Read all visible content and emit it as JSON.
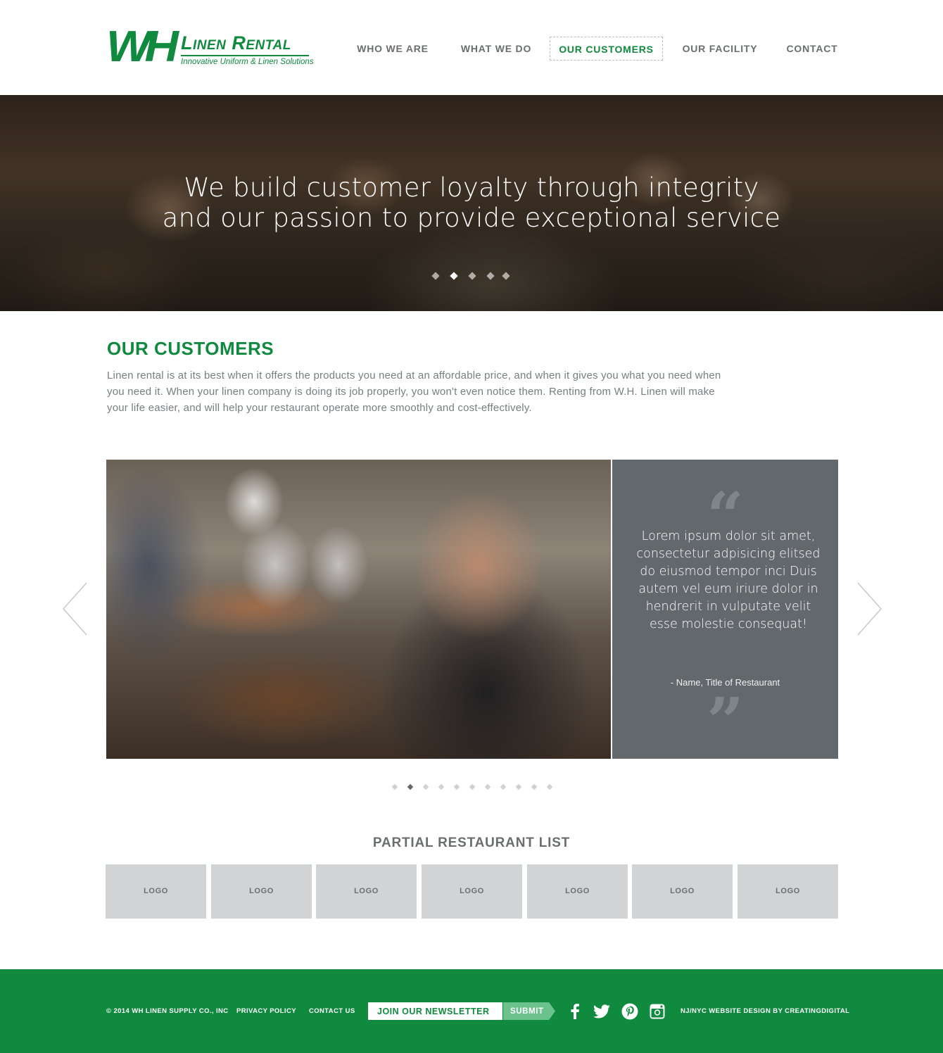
{
  "brand": {
    "logo_mark": "WH",
    "name": "Linen Rental",
    "tagline": "Innovative Uniform & Linen Solutions",
    "color": "#0f8a3e"
  },
  "nav": {
    "items": [
      {
        "label": "WHO WE ARE",
        "active": false
      },
      {
        "label": "WHAT WE DO",
        "active": false
      },
      {
        "label": "OUR CUSTOMERS",
        "active": true
      },
      {
        "label": "OUR FACILITY",
        "active": false
      },
      {
        "label": "CONTACT",
        "active": false
      }
    ]
  },
  "hero": {
    "line1": "We build customer loyalty through integrity",
    "line2": "and our passion to provide exceptional service",
    "slide_count": 5,
    "active_slide": 2
  },
  "intro": {
    "title": "OUR CUSTOMERS",
    "body": "Linen rental is at its best when it offers the products you need at an affordable price, and when it gives you what you need when you need it. When your linen company is doing its job properly, you won't even notice them. Renting from W.H. Linen will make your life easier, and will help your restaurant operate more smoothly and cost-effectively."
  },
  "testimonial": {
    "quote": "Lorem ipsum dolor sit amet, consectetur adpisicing elitsed do eiusmod tempor inci Duis autem vel eum iriure dolor in hendrerit in vulputate velit esse molestie consequat!",
    "author": "- Name, Title of Restaurant",
    "open_quote": "“",
    "close_quote": "”",
    "slide_count": 11,
    "active_slide": 2,
    "panel_color": "#62686b",
    "prev_icon": "chevron-left-icon",
    "next_icon": "chevron-right-icon"
  },
  "restaurants": {
    "title": "PARTIAL RESTAURANT LIST",
    "logos": [
      "LOGO",
      "LOGO",
      "LOGO",
      "LOGO",
      "LOGO",
      "LOGO",
      "LOGO"
    ]
  },
  "footer": {
    "copyright": "© 2014 WH LINEN SUPPLY CO., INC",
    "privacy": "PRIVACY POLICY",
    "contact": "CONTACT US",
    "newsletter_placeholder": "JOIN OUR NEWSLETTER",
    "submit_label": "SUBMIT",
    "social": [
      "facebook-icon",
      "twitter-icon",
      "pinterest-icon",
      "instagram-icon"
    ],
    "credit": "NJ/NYC WEBSITE DESIGN BY CREATINGDIGITAL",
    "background": "#0f8a3e",
    "submit_color": "#6cc28c"
  }
}
